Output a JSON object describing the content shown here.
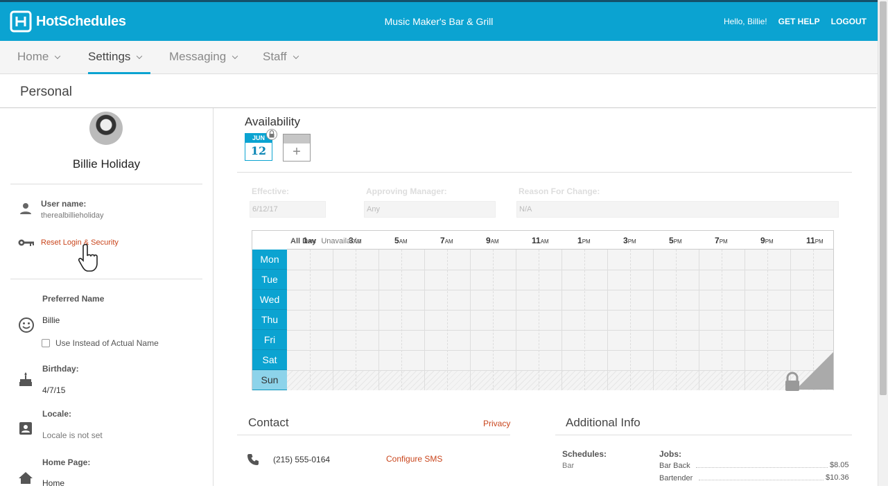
{
  "header": {
    "brand": "HotSchedules",
    "venue": "Music Maker's Bar & Grill",
    "greeting": "Hello, Billie!",
    "get_help": "GET HELP",
    "logout": "LOGOUT"
  },
  "nav": {
    "items": [
      {
        "label": "Home"
      },
      {
        "label": "Settings",
        "active": true
      },
      {
        "label": "Messaging"
      },
      {
        "label": "Staff"
      }
    ]
  },
  "page": {
    "title": "Personal"
  },
  "profile": {
    "full_name": "Billie Holiday",
    "username_label": "User name:",
    "username": "therealbillieholiday",
    "reset_link": "Reset Login & Security",
    "preferred_name_label": "Preferred Name",
    "preferred_name": "Billie",
    "use_instead_label": "Use Instead of Actual Name",
    "birthday_label": "Birthday:",
    "birthday": "4/7/15",
    "locale_label": "Locale:",
    "locale": "Locale is not set",
    "home_page_label": "Home Page:",
    "home_page": "Home"
  },
  "availability": {
    "title": "Availability",
    "tile_month": "JUN",
    "tile_day": "12",
    "add_label": "+",
    "effective_label": "Effective:",
    "effective_value": "6/12/17",
    "manager_label": "Approving Manager:",
    "manager_value": "Any",
    "reason_label": "Reason For Change:",
    "reason_value": "N/A",
    "hours": [
      {
        "h": "1",
        "p": "AM"
      },
      {
        "h": "3",
        "p": "AM"
      },
      {
        "h": "5",
        "p": "AM"
      },
      {
        "h": "7",
        "p": "AM"
      },
      {
        "h": "9",
        "p": "AM"
      },
      {
        "h": "11",
        "p": "AM"
      },
      {
        "h": "1",
        "p": "PM"
      },
      {
        "h": "3",
        "p": "PM"
      },
      {
        "h": "5",
        "p": "PM"
      },
      {
        "h": "7",
        "p": "PM"
      },
      {
        "h": "9",
        "p": "PM"
      },
      {
        "h": "11",
        "p": "PM"
      }
    ],
    "days": [
      "Mon",
      "Tue",
      "Wed",
      "Thu",
      "Fri",
      "Sat",
      "Sun"
    ],
    "sun_all_day": "All Day",
    "sun_status": "Unavailable"
  },
  "contact": {
    "title": "Contact",
    "privacy": "Privacy",
    "phone": "(215) 555-0164",
    "configure_sms": "Configure SMS"
  },
  "additional": {
    "title": "Additional Info",
    "schedules_label": "Schedules:",
    "schedules_value": "Bar",
    "jobs_label": "Jobs:",
    "jobs": [
      {
        "name": "Bar Back",
        "rate": "$8.05"
      },
      {
        "name": "Bartender",
        "rate": "$10.36"
      }
    ]
  },
  "colors": {
    "brand": "#0ba3d1",
    "link": "#c9451c"
  }
}
